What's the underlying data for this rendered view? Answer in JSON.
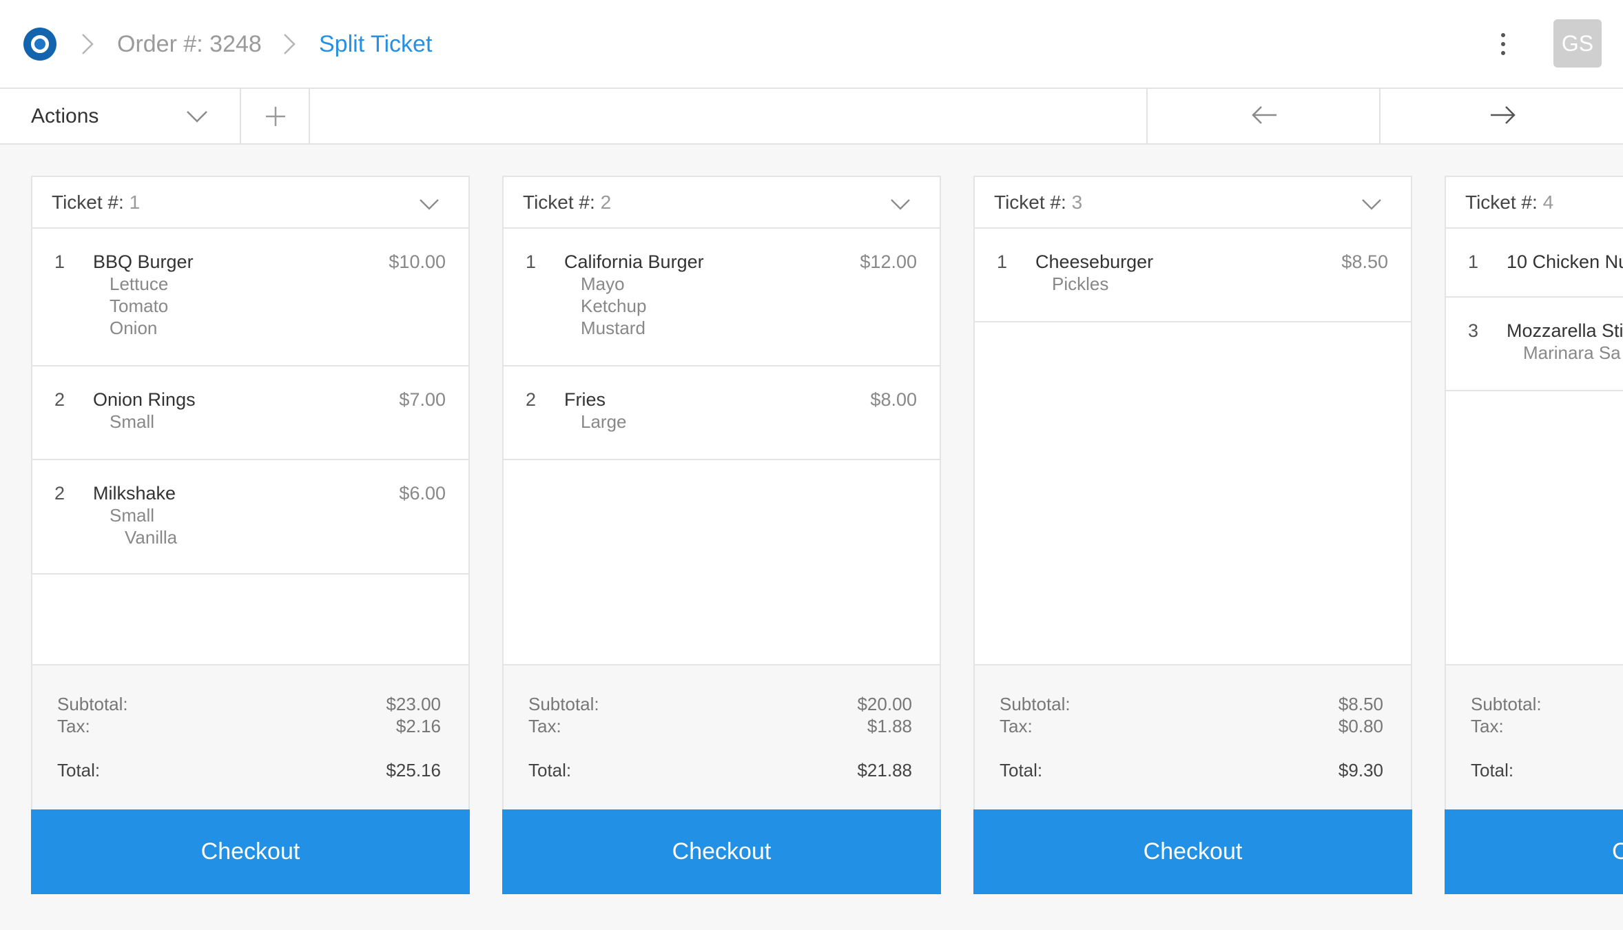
{
  "header": {
    "breadcrumb_order": "Order #: 3248",
    "breadcrumb_current": "Split Ticket",
    "avatar_initials": "GS"
  },
  "toolbar": {
    "actions_label": "Actions"
  },
  "tickets": [
    {
      "label": "Ticket #:",
      "number": "1",
      "items": [
        {
          "qty": "1",
          "name": "BBQ Burger",
          "price": "$10.00",
          "modifiers": [
            "Lettuce",
            "Tomato",
            "Onion"
          ]
        },
        {
          "qty": "2",
          "name": "Onion Rings",
          "price": "$7.00",
          "modifiers": [
            "Small"
          ]
        },
        {
          "qty": "2",
          "name": "Milkshake",
          "price": "$6.00",
          "modifiers": [
            "Small",
            "Vanilla"
          ]
        }
      ],
      "subtotal_label": "Subtotal:",
      "subtotal": "$23.00",
      "tax_label": "Tax:",
      "tax": "$2.16",
      "total_label": "Total:",
      "total": "$25.16",
      "checkout_label": "Checkout"
    },
    {
      "label": "Ticket #:",
      "number": "2",
      "items": [
        {
          "qty": "1",
          "name": "California Burger",
          "price": "$12.00",
          "modifiers": [
            "Mayo",
            "Ketchup",
            "Mustard"
          ]
        },
        {
          "qty": "2",
          "name": "Fries",
          "price": "$8.00",
          "modifiers": [
            "Large"
          ]
        }
      ],
      "subtotal_label": "Subtotal:",
      "subtotal": "$20.00",
      "tax_label": "Tax:",
      "tax": "$1.88",
      "total_label": "Total:",
      "total": "$21.88",
      "checkout_label": "Checkout"
    },
    {
      "label": "Ticket #:",
      "number": "3",
      "items": [
        {
          "qty": "1",
          "name": "Cheeseburger",
          "price": "$8.50",
          "modifiers": [
            "Pickles"
          ]
        }
      ],
      "subtotal_label": "Subtotal:",
      "subtotal": "$8.50",
      "tax_label": "Tax:",
      "tax": "$0.80",
      "total_label": "Total:",
      "total": "$9.30",
      "checkout_label": "Checkout"
    },
    {
      "label": "Ticket #:",
      "number": "4",
      "items": [
        {
          "qty": "1",
          "name": "10 Chicken Nu",
          "price": "",
          "modifiers": []
        },
        {
          "qty": "3",
          "name": "Mozzarella Sti",
          "price": "",
          "modifiers": [
            "Marinara Sa"
          ]
        }
      ],
      "subtotal_label": "Subtotal:",
      "subtotal": "",
      "tax_label": "Tax:",
      "tax": "",
      "total_label": "Total:",
      "total": "",
      "checkout_label": "C"
    }
  ],
  "colors": {
    "accent": "#2290e4",
    "link": "#2690e3",
    "logo": "#1363ad"
  },
  "icons": [
    "logo-icon",
    "chevron-right-icon",
    "more-vertical-icon",
    "chevron-down-icon",
    "plus-icon",
    "arrow-left-icon",
    "arrow-right-icon"
  ]
}
